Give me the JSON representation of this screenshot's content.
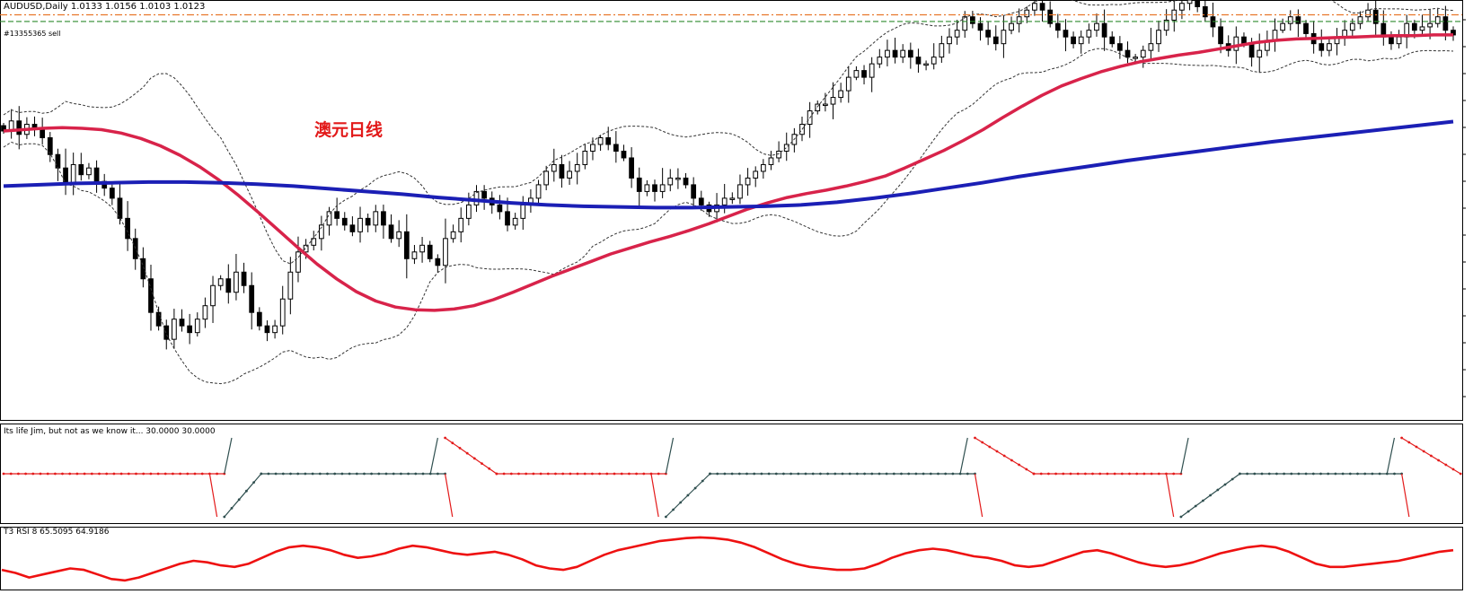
{
  "window": {
    "title": "AUDUSD,Daily  1.0133 1.0156 1.0103 1.0123",
    "order_label": "#13355365 sell",
    "annotation": "澳元日线"
  },
  "indicators": {
    "jim": {
      "title": "Its life Jim, but not as we know it... 30.0000 30.0000"
    },
    "rsi": {
      "title": "T3 RSI 8 65.5095 64.9186"
    }
  },
  "colors": {
    "bull_candle": "#ffffff",
    "bear_candle": "#000000",
    "ma_fast": "#d8234a",
    "ma_slow": "#1b1fb5",
    "bollinger": "#333333",
    "order_line": "#e8762a",
    "stop_line": "#2e8b2e",
    "indicator_up": "#2f4f4f",
    "indicator_down": "#e31b1b",
    "rsi_line": "#ee1111"
  },
  "chart_data": [
    {
      "type": "candlestick",
      "title": "AUDUSD,Daily",
      "ohlc_last": {
        "open": 1.0133,
        "high": 1.0156,
        "low": 1.0103,
        "close": 1.0123
      },
      "ylim": [
        0.955,
        1.0175
      ],
      "y_scale_note": "no price axis labels visible; values estimated",
      "series": [
        {
          "name": "",
          "kind": "candles",
          "closes": [
            0.998,
            0.9995,
            0.9975,
            0.999,
            0.9985,
            0.997,
            0.9945,
            0.9925,
            0.99,
            0.993,
            0.9915,
            0.9925,
            0.9905,
            0.9895,
            0.988,
            0.985,
            0.982,
            0.979,
            0.976,
            0.971,
            0.969,
            0.967,
            0.97,
            0.969,
            0.968,
            0.97,
            0.972,
            0.975,
            0.976,
            0.974,
            0.977,
            0.975,
            0.971,
            0.969,
            0.968,
            0.969,
            0.973,
            0.977,
            0.98,
            0.981,
            0.982,
            0.984,
            0.986,
            0.985,
            0.984,
            0.983,
            0.985,
            0.984,
            0.986,
            0.984,
            0.982,
            0.983,
            0.979,
            0.98,
            0.981,
            0.979,
            0.978,
            0.982,
            0.983,
            0.985,
            0.987,
            0.989,
            0.988,
            0.987,
            0.986,
            0.984,
            0.985,
            0.987,
            0.988,
            0.99,
            0.992,
            0.993,
            0.991,
            0.992,
            0.993,
            0.995,
            0.996,
            0.997,
            0.996,
            0.995,
            0.994,
            0.991,
            0.989,
            0.99,
            0.989,
            0.99,
            0.991,
            0.991,
            0.99,
            0.988,
            0.987,
            0.986,
            0.987,
            0.988,
            0.988,
            0.99,
            0.991,
            0.992,
            0.993,
            0.994,
            0.995,
            0.996,
            0.9975,
            0.999,
            1.001,
            1.002,
            1.002,
            1.003,
            1.004,
            1.006,
            1.007,
            1.006,
            1.008,
            1.009,
            1.01,
            1.009,
            1.01,
            1.009,
            1.008,
            1.008,
            1.009,
            1.011,
            1.012,
            1.013,
            1.015,
            1.014,
            1.013,
            1.012,
            1.011,
            1.013,
            1.014,
            1.015,
            1.016,
            1.017,
            1.016,
            1.014,
            1.013,
            1.012,
            1.011,
            1.012,
            1.013,
            1.014,
            1.012,
            1.011,
            1.01,
            1.009,
            1.009,
            1.01,
            1.011,
            1.013,
            1.0145,
            1.016,
            1.017,
            1.0175,
            1.0165,
            1.015,
            1.0135,
            1.011,
            1.01,
            1.012,
            1.011,
            1.009,
            1.01,
            1.0115,
            1.013,
            1.014,
            1.015,
            1.014,
            1.0125,
            1.011,
            1.01,
            1.011,
            1.012,
            1.013,
            1.014,
            1.015,
            1.016,
            1.014,
            1.012,
            1.011,
            1.012,
            1.014,
            1.013,
            1.0135,
            1.014,
            1.015,
            1.013,
            1.0123
          ]
        },
        {
          "name": "",
          "kind": "ma_fast",
          "values": [
            0.998,
            0.9982,
            0.9984,
            0.9985,
            0.9984,
            0.9982,
            0.9977,
            0.9969,
            0.9958,
            0.9944,
            0.9927,
            0.9907,
            0.9884,
            0.9859,
            0.9833,
            0.9807,
            0.9782,
            0.976,
            0.9741,
            0.9727,
            0.9718,
            0.9714,
            0.9713,
            0.9715,
            0.972,
            0.9729,
            0.974,
            0.9752,
            0.9764,
            0.9775,
            0.9786,
            0.9797,
            0.9806,
            0.9815,
            0.9823,
            0.9832,
            0.9842,
            0.9853,
            0.9864,
            0.9873,
            0.9881,
            0.9887,
            0.9892,
            0.9898,
            0.9905,
            0.9913,
            0.9925,
            0.9938,
            0.9951,
            0.9966,
            0.9982,
            1.0,
            1.0017,
            1.0033,
            1.0047,
            1.0058,
            1.0068,
            1.0076,
            1.0083,
            1.0088,
            1.0093,
            1.0097,
            1.0102,
            1.0107,
            1.0112,
            1.0115,
            1.0117,
            1.0118,
            1.0119,
            1.012,
            1.0121,
            1.0122,
            1.0122,
            1.0123,
            1.0123
          ]
        },
        {
          "name": "",
          "kind": "ma_slow",
          "values": [
            0.9898,
            0.99,
            0.9902,
            0.9903,
            0.9904,
            0.9904,
            0.9903,
            0.9901,
            0.9898,
            0.9894,
            0.989,
            0.9886,
            0.9881,
            0.9877,
            0.9873,
            0.987,
            0.9868,
            0.9867,
            0.9866,
            0.9866,
            0.9867,
            0.9868,
            0.987,
            0.9874,
            0.988,
            0.9887,
            0.9895,
            0.9903,
            0.9912,
            0.992,
            0.9928,
            0.9936,
            0.9943,
            0.995,
            0.9957,
            0.9964,
            0.997,
            0.9976,
            0.9982,
            0.9988,
            0.9994
          ]
        }
      ],
      "horizontal_lines": [
        {
          "label": "#13355365 sell",
          "price": 1.0153
        },
        {
          "price": 1.0143
        }
      ]
    },
    {
      "type": "line",
      "title": "Its life Jim, but not as we know it... 30.0000 30.0000",
      "series": [
        {
          "name": "",
          "segments": [
            {
              "from": 0,
              "to": 30,
              "level": "mid",
              "dir": "down"
            },
            {
              "from": 30,
              "to": 35,
              "level": "low",
              "dir": "up"
            },
            {
              "from": 35,
              "to": 60,
              "level": "mid",
              "dir": "up"
            },
            {
              "from": 60,
              "to": 67,
              "level": "high",
              "dir": "down"
            },
            {
              "from": 67,
              "to": 90,
              "level": "mid",
              "dir": "down"
            },
            {
              "from": 90,
              "to": 96,
              "level": "low",
              "dir": "up"
            },
            {
              "from": 96,
              "to": 132,
              "level": "mid",
              "dir": "up"
            },
            {
              "from": 132,
              "to": 140,
              "level": "high",
              "dir": "down"
            },
            {
              "from": 140,
              "to": 160,
              "level": "mid",
              "dir": "down"
            },
            {
              "from": 160,
              "to": 168,
              "level": "low",
              "dir": "up"
            },
            {
              "from": 168,
              "to": 190,
              "level": "mid",
              "dir": "up"
            },
            {
              "from": 190,
              "to": 198,
              "level": "high",
              "dir": "down"
            }
          ]
        }
      ]
    },
    {
      "type": "line",
      "title": "T3 RSI 8 65.5095 64.9186",
      "series": [
        {
          "name": "",
          "values": [
            40,
            36,
            30,
            34,
            38,
            42,
            40,
            34,
            28,
            26,
            30,
            36,
            42,
            48,
            52,
            50,
            46,
            44,
            48,
            56,
            64,
            70,
            72,
            70,
            66,
            60,
            56,
            58,
            62,
            68,
            72,
            70,
            66,
            62,
            60,
            62,
            64,
            60,
            54,
            46,
            42,
            40,
            44,
            52,
            60,
            66,
            70,
            74,
            78,
            80,
            82,
            83,
            82,
            80,
            76,
            70,
            62,
            54,
            48,
            44,
            42,
            40,
            40,
            42,
            48,
            56,
            62,
            66,
            68,
            66,
            62,
            58,
            56,
            52,
            46,
            44,
            46,
            52,
            58,
            64,
            66,
            62,
            56,
            50,
            46,
            44,
            46,
            50,
            56,
            62,
            66,
            70,
            72,
            70,
            64,
            56,
            48,
            44,
            44,
            46,
            48,
            50,
            52,
            56,
            60,
            64,
            66
          ]
        }
      ]
    }
  ]
}
